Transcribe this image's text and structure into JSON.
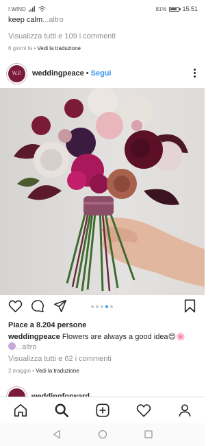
{
  "status": {
    "carrier": "I WIND",
    "battery": "81%",
    "battery_level": 0.81,
    "time": "15:51"
  },
  "previous_post": {
    "caption_tail": "keep calm",
    "more": "...altro",
    "comments": "Visualizza tutti e 109 i commenti",
    "age": "6 giorni fa",
    "translate": "Vedi la traduzione"
  },
  "post": {
    "avatar_initials": "W.P.",
    "username": "weddingpeace",
    "separator": "•",
    "follow": "Segui",
    "likes": "Piace a 8.204 persone",
    "caption_user": "weddingpeace",
    "caption_text": "Flowers are always a good idea",
    "caption_emoji": "😍🌸",
    "caption_more": "...altro",
    "comments": "Visualizza tutti e 62 i commenti",
    "date": "2 maggio",
    "translate": "Vedi la traduzione",
    "carousel_count": 5,
    "carousel_active": 4
  },
  "next_post": {
    "username": "weddingforward"
  },
  "icons": {
    "like": "heart-icon",
    "comment": "comment-icon",
    "share": "send-icon",
    "save": "bookmark-icon",
    "home": "home-icon",
    "search": "search-icon",
    "new_post": "add-post-icon",
    "activity": "heart-icon",
    "profile": "profile-icon"
  },
  "colors": {
    "link": "#3897f0",
    "text": "#262626",
    "secondary": "#8e8e8e",
    "bouquet_burgundy": "#5c1028",
    "bouquet_magenta": "#a8185a"
  }
}
